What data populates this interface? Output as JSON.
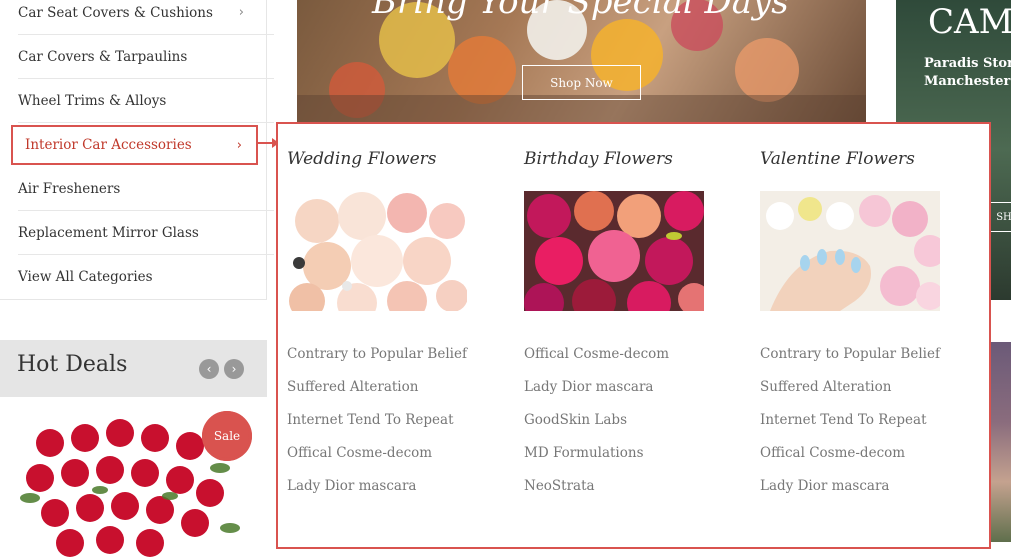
{
  "sidebar": {
    "items": [
      {
        "label": "Car Seat Covers & Cushions",
        "chevron": "›"
      },
      {
        "label": "Car Covers & Tarpaulins",
        "chevron": ""
      },
      {
        "label": "Wheel Trims & Alloys",
        "chevron": ""
      },
      {
        "label": "Interior Car Accessories",
        "chevron": "›"
      },
      {
        "label": "Air Fresheners",
        "chevron": ""
      },
      {
        "label": "Replacement Mirror Glass",
        "chevron": ""
      },
      {
        "label": "View All Categories",
        "chevron": ""
      }
    ]
  },
  "hot_deals": {
    "title": "Hot Deals",
    "prev_icon": "‹",
    "next_icon": "›",
    "badge": "Sale",
    "image": "red-roses-bouquet"
  },
  "banner_main": {
    "title": "Bring Your Special Days",
    "button": "Shop Now"
  },
  "banner_right": {
    "big": "CAM",
    "line1": "Paradis Stor",
    "line2": "Manchester",
    "mini_button": "SH"
  },
  "mega_menu": {
    "columns": [
      {
        "title": "Wedding Flowers",
        "image": "peach-roses-bouquet",
        "links": [
          "Contrary to Popular Belief",
          "Suffered Alteration",
          "Internet Tend To Repeat",
          "Offical Cosme-decom",
          "Lady Dior mascara"
        ]
      },
      {
        "title": "Birthday Flowers",
        "image": "pink-peonies-bouquet",
        "links": [
          "Offical Cosme-decom",
          "Lady Dior mascara",
          "GoodSkin Labs",
          "MD Formulations",
          "NeoStrata"
        ]
      },
      {
        "title": "Valentine Flowers",
        "image": "hand-with-flowers",
        "links": [
          "Contrary to Popular Belief",
          "Suffered Alteration",
          "Internet Tend To Repeat",
          "Offical Cosme-decom",
          "Lady Dior mascara"
        ]
      }
    ]
  },
  "colors": {
    "accent": "#d9534f",
    "hot_deals_bg": "#e5e5e5",
    "link_gray": "#777777"
  }
}
